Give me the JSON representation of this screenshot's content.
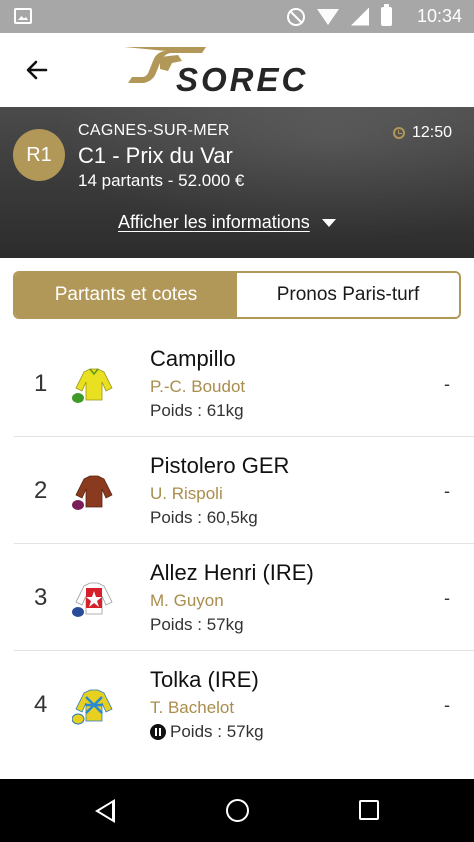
{
  "status_bar": {
    "time": "10:34"
  },
  "header": {
    "logo_text": "SOREC"
  },
  "race": {
    "round": "R1",
    "venue": "CAGNES-SUR-MER",
    "title": "C1 - Prix du Var",
    "meta": "14 partants - 52.000 €",
    "time": "12:50",
    "info_toggle_label": "Afficher les informations"
  },
  "tabs": [
    {
      "label": "Partants et cotes",
      "active": true
    },
    {
      "label": "Pronos Paris-turf",
      "active": false
    }
  ],
  "runners": [
    {
      "number": "1",
      "name": "Campillo",
      "jockey": "P.-C. Boudot",
      "weight": "Poids : 61kg",
      "odds": "-",
      "silk": "yellow-green"
    },
    {
      "number": "2",
      "name": "Pistolero GER",
      "jockey": "U. Rispoli",
      "weight": "Poids : 60,5kg",
      "odds": "-",
      "silk": "brown"
    },
    {
      "number": "3",
      "name": "Allez Henri (IRE)",
      "jockey": "M. Guyon",
      "weight": "Poids : 57kg",
      "odds": "-",
      "silk": "red-white-star"
    },
    {
      "number": "4",
      "name": "Tolka (IRE)",
      "jockey": "T. Bachelot",
      "weight": "Poids : 57kg",
      "odds": "-",
      "silk": "yellow-blue-diamonds",
      "badge": "pause-icon"
    }
  ],
  "colors": {
    "gold": "#b19758",
    "jockey_text": "#a98d4d",
    "banner_dark": "#3c3c3c"
  }
}
